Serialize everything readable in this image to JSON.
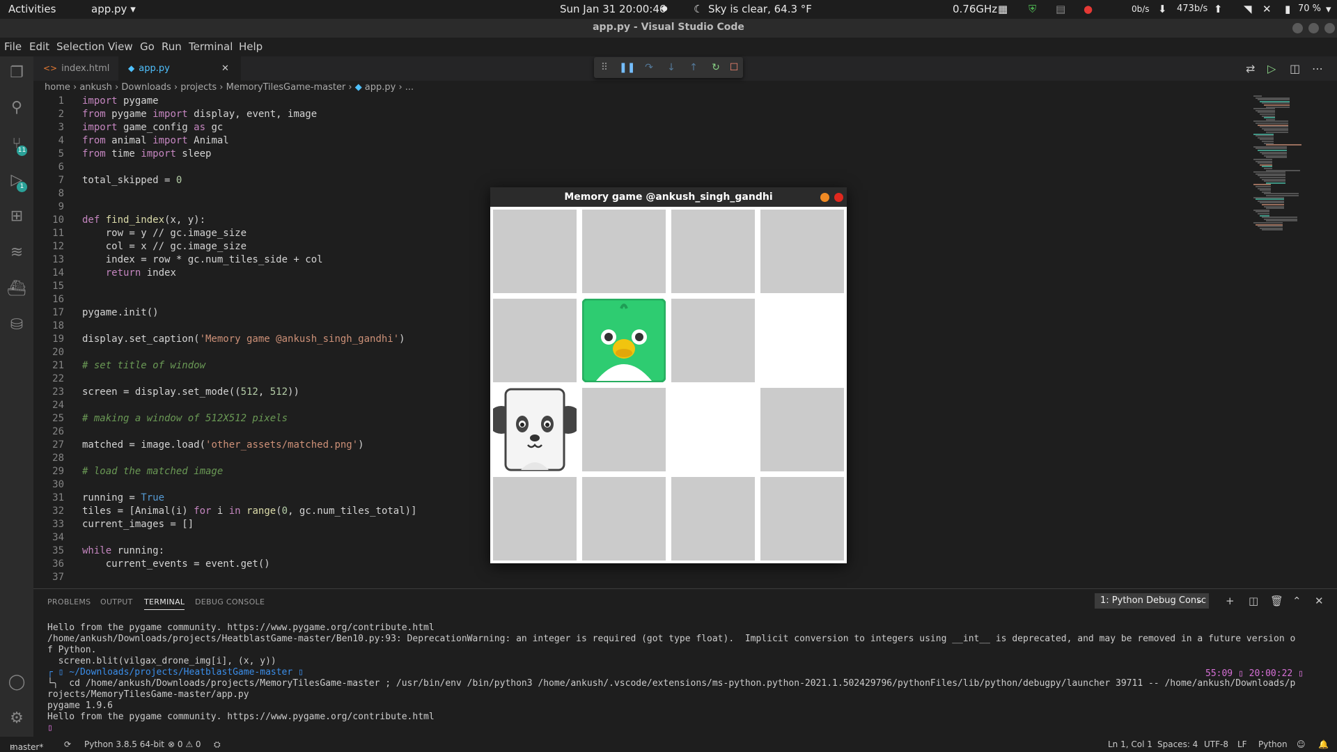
{
  "topbar": {
    "activities": "Activities",
    "app": "app.py",
    "datetime": "Sun Jan 31  20:00:46",
    "weather": "Sky is clear, 64.3 °F",
    "cpu": "0.76GHz",
    "net_down": "0b/s",
    "net_up": "473b/s",
    "battery": "70 %"
  },
  "window": {
    "title": "app.py - Visual Studio Code"
  },
  "menu": [
    "File",
    "Edit",
    "Selection",
    "View",
    "Go",
    "Run",
    "Terminal",
    "Help"
  ],
  "tabs": [
    {
      "label": "index.html",
      "icon": "<>"
    },
    {
      "label": "app.py",
      "icon": "◆"
    }
  ],
  "breadcrumb": [
    "home",
    "ankush",
    "Downloads",
    "projects",
    "MemoryTilesGame-master",
    "app.py",
    "..."
  ],
  "badges": {
    "scm": "11",
    "debug": "1"
  },
  "code_lines": [
    "import pygame",
    "from pygame import display, event, image",
    "import game_config as gc",
    "from animal import Animal",
    "from time import sleep",
    "",
    "total_skipped = 0",
    "",
    "",
    "def find_index(x, y):",
    "    row = y // gc.image_size",
    "    col = x // gc.image_size",
    "    index = row * gc.num_tiles_side + col",
    "    return index",
    "",
    "",
    "pygame.init()",
    "",
    "display.set_caption('Memory game @ankush_singh_gandhi')",
    "",
    "# set title of window",
    "",
    "screen = display.set_mode((512, 512))",
    "",
    "# making a window of 512X512 pixels",
    "",
    "matched = image.load('other_assets/matched.png')",
    "",
    "# load the matched image",
    "",
    "running = True",
    "tiles = [Animal(i) for i in range(0, gc.num_tiles_total)]",
    "current_images = []",
    "",
    "while running:",
    "    current_events = event.get()",
    ""
  ],
  "game": {
    "title": "Memory game @ankush_singh_gandhi",
    "grid": [
      [
        "hidden",
        "hidden",
        "hidden",
        "hidden"
      ],
      [
        "hidden",
        "parrot",
        "hidden",
        "matched"
      ],
      [
        "panda",
        "hidden",
        "matched",
        "hidden"
      ],
      [
        "hidden",
        "hidden",
        "hidden",
        "hidden"
      ]
    ]
  },
  "panel": {
    "tabs": [
      "PROBLEMS",
      "OUTPUT",
      "TERMINAL",
      "DEBUG CONSOLE"
    ],
    "active_tab": "TERMINAL",
    "console_select": "1: Python Debug Consc"
  },
  "terminal_lines": [
    "Hello from the pygame community. https://www.pygame.org/contribute.html",
    "/home/ankush/Downloads/projects/HeatblastGame-master/Ben10.py:93: DeprecationWarning: an integer is required (got type float).  Implicit conversion to integers using __int__ is deprecated, and may be removed in a future version o",
    "f Python.",
    "  screen.blit(vilgax_drone_img[i], (x, y))",
    "┌ ▯ ~/Downloads/projects/HeatblastGame-master ▯",
    "└╮  cd /home/ankush/Downloads/projects/MemoryTilesGame-master ; /usr/bin/env /bin/python3 /home/ankush/.vscode/extensions/ms-python.python-2021.1.502429796/pythonFiles/lib/python/debugpy/launcher 39711 -- /home/ankush/Downloads/p",
    "rojects/MemoryTilesGame-master/app.py",
    "pygame 1.9.6",
    "Hello from the pygame community. https://www.pygame.org/contribute.html",
    "▯"
  ],
  "terminal_right": "55:09 ▯  20:00:22 ▯",
  "statusbar": {
    "branch": "master*",
    "python": "Python 3.8.5 64-bit",
    "problems": "⊗ 0 ⚠ 0",
    "position": "Ln 1, Col 1",
    "spaces": "Spaces: 4",
    "encoding": "UTF-8",
    "eol": "LF",
    "language": "Python"
  }
}
